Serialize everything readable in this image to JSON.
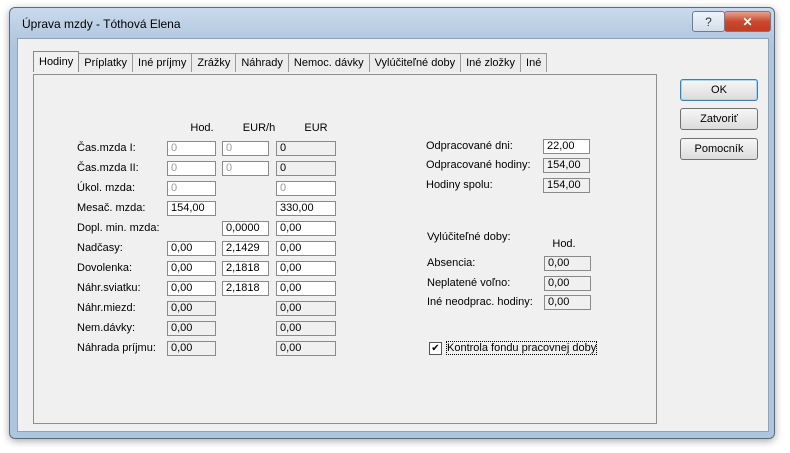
{
  "window": {
    "title": "Úprava mzdy -  Tóthová Elena",
    "help_label": "?",
    "close_label": "✕"
  },
  "tabs": [
    {
      "label": "Hodiny"
    },
    {
      "label": "Príplatky"
    },
    {
      "label": "Iné príjmy"
    },
    {
      "label": "Zrážky"
    },
    {
      "label": "Náhrady"
    },
    {
      "label": "Nemoc. dávky"
    },
    {
      "label": "Vylúčiteľné doby"
    },
    {
      "label": "Iné zložky"
    },
    {
      "label": "Iné"
    }
  ],
  "hodiny": {
    "col_hod": "Hod.",
    "col_eurh": "EUR/h",
    "col_eur": "EUR",
    "rows": [
      {
        "label": "Čas.mzda I:",
        "hod": "0",
        "eurh": "0",
        "eur": "0"
      },
      {
        "label": "Čas.mzda II:",
        "hod": "0",
        "eurh": "0",
        "eur": "0"
      },
      {
        "label": "Úkol. mzda:",
        "hod": "0",
        "eur": "0"
      },
      {
        "label": "Mesač. mzda:",
        "hod": "154,00",
        "eur": "330,00"
      },
      {
        "label": "Dopl. min. mzda:",
        "eurh": "0,0000",
        "eur": "0,00"
      },
      {
        "label": "Nadčasy:",
        "hod": "0,00",
        "eurh": "2,1429",
        "eur": "0,00"
      },
      {
        "label": "Dovolenka:",
        "hod": "0,00",
        "eurh": "2,1818",
        "eur": "0,00"
      },
      {
        "label": "Náhr.sviatku:",
        "hod": "0,00",
        "eurh": "2,1818",
        "eur": "0,00"
      },
      {
        "label": "Náhr.miezd:",
        "hod": "0,00",
        "eur": "0,00"
      },
      {
        "label": "Nem.dávky:",
        "hod": "0,00",
        "eur": "0,00"
      },
      {
        "label": "Náhrada príjmu:",
        "hod": "0,00",
        "eur": "0,00"
      }
    ]
  },
  "summary": [
    {
      "label": "Odpracované dni:",
      "value": "22,00"
    },
    {
      "label": "Odpracované hodiny:",
      "value": "154,00"
    },
    {
      "label": "Hodiny spolu:",
      "value": "154,00"
    }
  ],
  "vylucitelne": {
    "title": "Vylúčiteľné doby:",
    "col_hod": "Hod.",
    "rows": [
      {
        "label": "Absencia:",
        "value": "0,00"
      },
      {
        "label": "Neplatené voľno:",
        "value": "0,00"
      },
      {
        "label": "Iné neodprac. hodiny:",
        "value": "0,00"
      }
    ]
  },
  "kontrola": {
    "label": "Kontrola fondu pracovnej doby",
    "checked": true,
    "check_glyph": "✔"
  },
  "buttons": {
    "ok": "OK",
    "zatvorit": "Zatvoriť",
    "pomocnik": "Pomocník"
  }
}
